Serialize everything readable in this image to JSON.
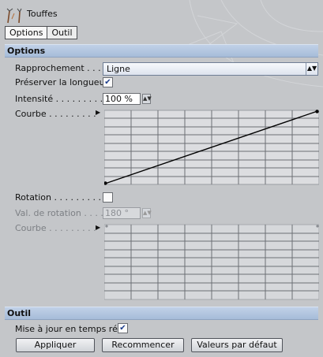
{
  "tool": {
    "title": "Touffes",
    "icon": "hair-tufts-icon"
  },
  "tabs": [
    {
      "label": "Options",
      "active": true
    },
    {
      "label": "Outil",
      "active": false
    }
  ],
  "options_section": {
    "title": "Options",
    "rapprochement": {
      "label": "Rapprochement . . . .",
      "value": "Ligne"
    },
    "preserver": {
      "label": "Préserver la longueur",
      "checked": true
    },
    "intensite": {
      "label": "Intensité . . . . . . . . . .",
      "value": "100 %"
    },
    "courbe": {
      "label": "Courbe . . . . . . . . ."
    },
    "rotation": {
      "label": "Rotation . . . . . . . . . .",
      "checked": false
    },
    "val_rotation": {
      "label": "Val. de rotation . . . . .",
      "value": "180 °"
    },
    "courbe2": {
      "label": "Courbe . . . . . . . . ."
    }
  },
  "outil_section": {
    "title": "Outil",
    "realtime": {
      "label": "Mise à jour en temps réel",
      "checked": true
    },
    "buttons": {
      "apply": "Appliquer",
      "reset": "Recommencer",
      "defaults": "Valeurs par défaut"
    }
  },
  "colors": {
    "panel": "#c4c6c9",
    "section_header": "#afc2dd",
    "graph_bg": "#dcdde0"
  }
}
